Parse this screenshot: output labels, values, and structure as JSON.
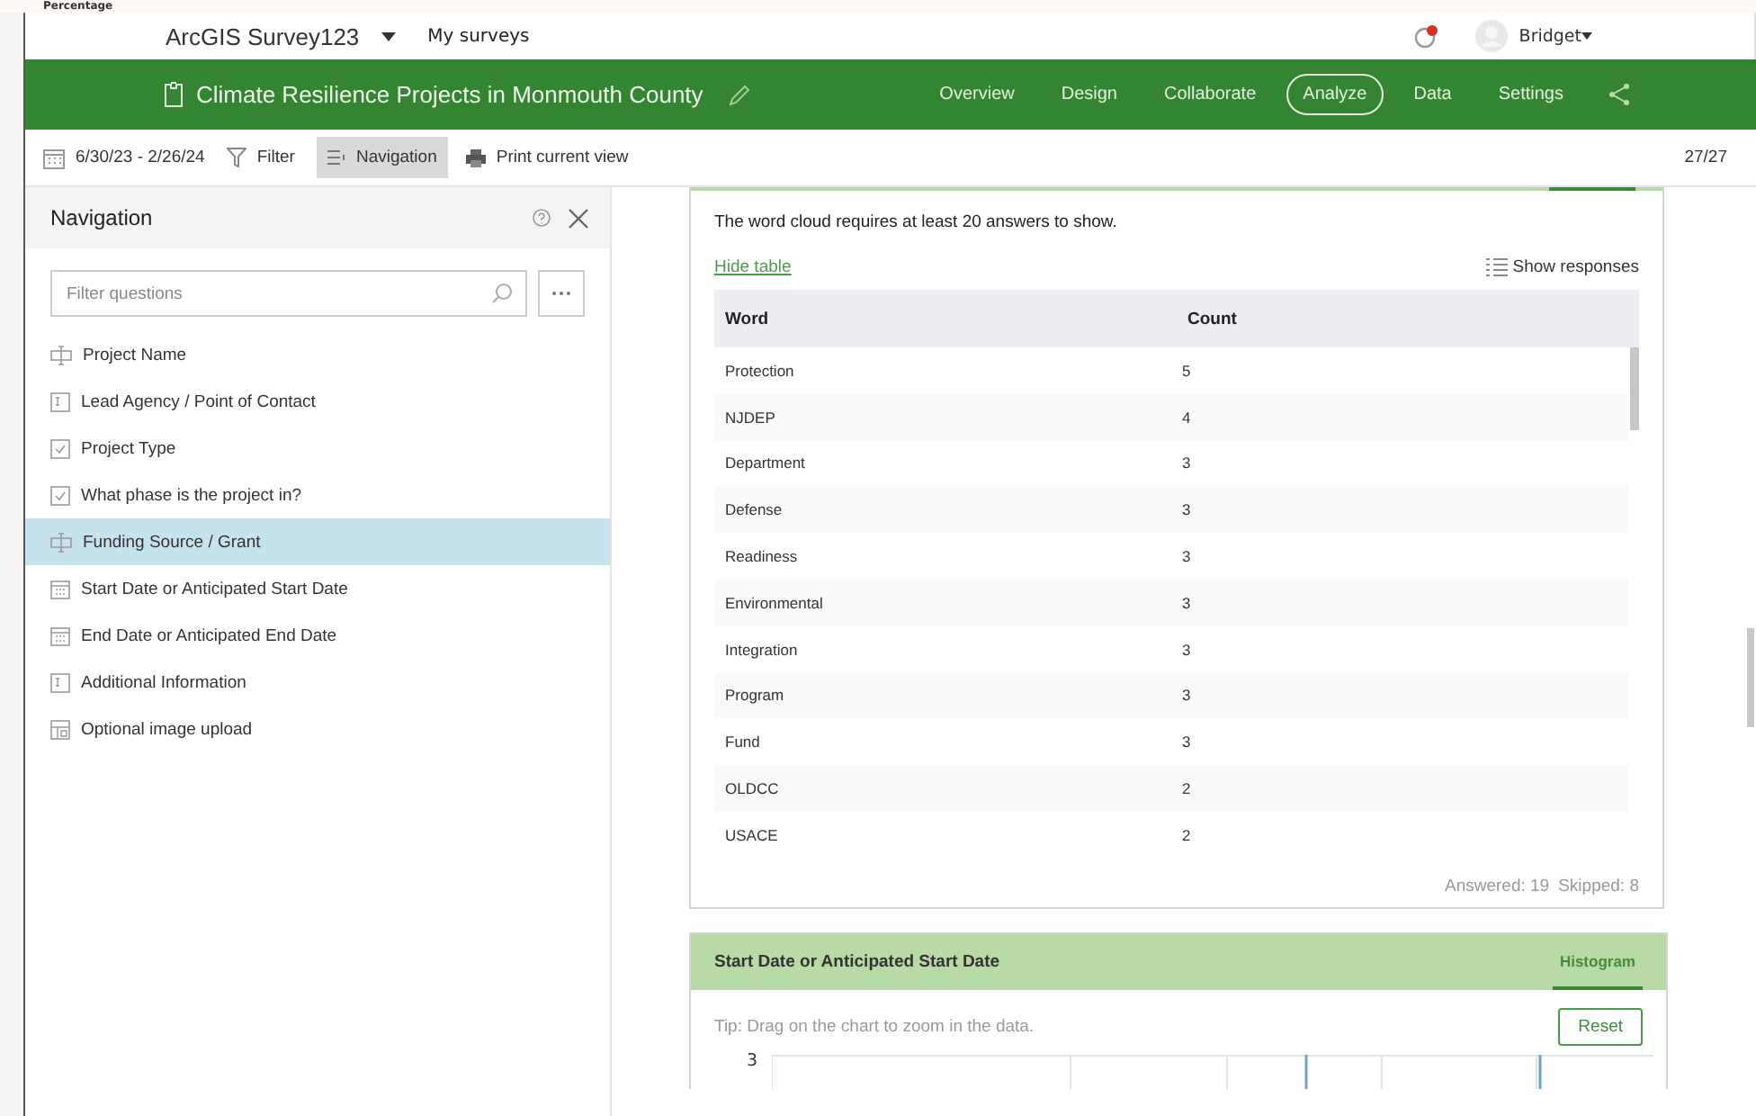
{
  "background_label": "Percentage",
  "top_bar": {
    "app_name": "ArcGIS Survey123",
    "my_surveys": "My surveys",
    "user": "Bridget",
    "notification": true
  },
  "survey_bar": {
    "title": "Climate Resilience Projects in Monmouth County",
    "tabs": [
      {
        "label": "Overview",
        "selected": false
      },
      {
        "label": "Design",
        "selected": false
      },
      {
        "label": "Collaborate",
        "selected": false
      },
      {
        "label": "Analyze",
        "selected": true
      },
      {
        "label": "Data",
        "selected": false
      },
      {
        "label": "Settings",
        "selected": false
      }
    ]
  },
  "toolbar": {
    "date_range": "6/30/23 - 2/26/24",
    "filter": "Filter",
    "navigation": {
      "label": "Navigation",
      "selected": true
    },
    "print": "Print current view",
    "count": "27/27"
  },
  "navigation": {
    "title": "Navigation",
    "search": {
      "placeholder": "Filter questions"
    },
    "items": [
      {
        "kind": "text",
        "label": "Project Name",
        "selected": false
      },
      {
        "kind": "multiline",
        "label": "Lead Agency / Point of Contact",
        "selected": false
      },
      {
        "kind": "checkbox",
        "label": "Project Type",
        "selected": false
      },
      {
        "kind": "checkbox",
        "label": "What phase is the project in?",
        "selected": false
      },
      {
        "kind": "text",
        "label": "Funding Source / Grant",
        "selected": true
      },
      {
        "kind": "date",
        "label": "Start Date or Anticipated Start Date",
        "selected": false
      },
      {
        "kind": "date",
        "label": "End Date or Anticipated End Date",
        "selected": false
      },
      {
        "kind": "multiline",
        "label": "Additional Information",
        "selected": false
      },
      {
        "kind": "image",
        "label": "Optional image upload",
        "selected": false
      }
    ]
  },
  "word_card": {
    "note": "The word cloud requires at least 20 answers to show.",
    "hide_table": "Hide table",
    "show_responses": "Show responses",
    "table": {
      "columns": [
        "Word",
        "Count"
      ],
      "rows": [
        [
          "Protection",
          "5"
        ],
        [
          "NJDEP",
          "4"
        ],
        [
          "Department",
          "3"
        ],
        [
          "Defense",
          "3"
        ],
        [
          "Readiness",
          "3"
        ],
        [
          "Environmental",
          "3"
        ],
        [
          "Integration",
          "3"
        ],
        [
          "Program",
          "3"
        ],
        [
          "Fund",
          "3"
        ],
        [
          "OLDCC",
          "2"
        ],
        [
          "USACE",
          "2"
        ]
      ]
    },
    "answered": "Answered: 19",
    "skipped": "Skipped: 8"
  },
  "date_card": {
    "title": "Start Date or Anticipated Start Date",
    "tab": {
      "label": "Histogram",
      "selected": true
    },
    "tip": "Tip: Drag on the chart to zoom in the data.",
    "reset": "Reset",
    "y_tick": "3"
  }
}
